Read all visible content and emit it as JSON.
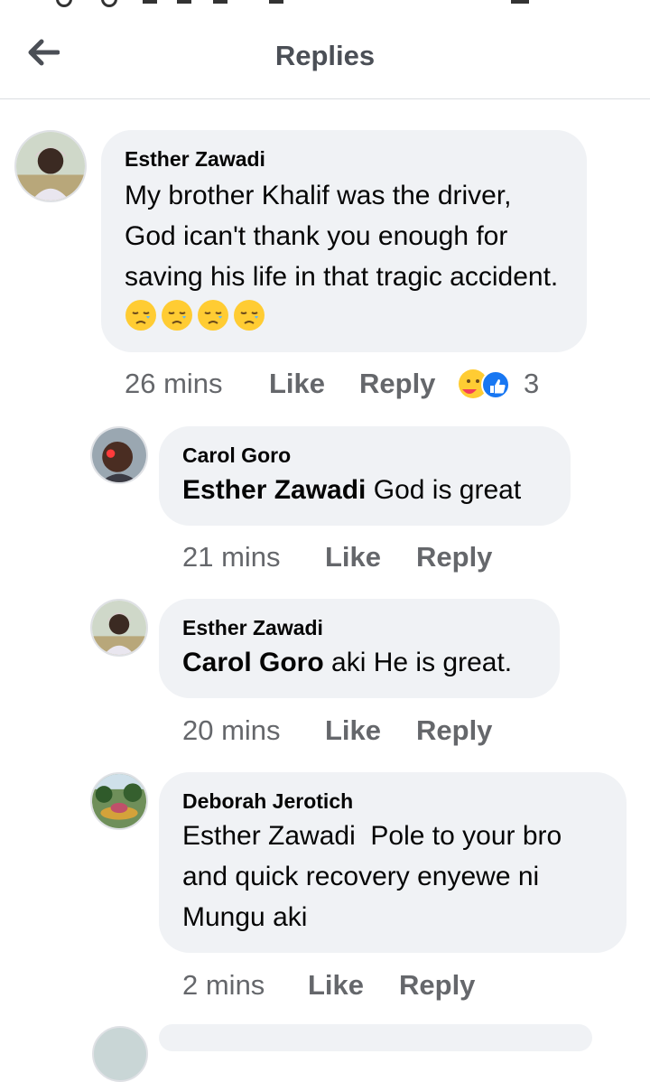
{
  "header": {
    "title": "Replies",
    "back_icon": "arrow-left-icon"
  },
  "comments": [
    {
      "author": "Esther Zawadi",
      "mention": "",
      "text": "My brother Khalif was the driver, God ican't thank you enough for saving his life in that tragic accident.",
      "time": "26 mins",
      "like_label": "Like",
      "reply_label": "Reply",
      "reaction_count": "3",
      "reactions": [
        "care-emoji-icon",
        "like-icon"
      ]
    },
    {
      "author": "Carol Goro",
      "mention": "Esther Zawadi",
      "text": "God is great",
      "time": "21 mins",
      "like_label": "Like",
      "reply_label": "Reply"
    },
    {
      "author": "Esther Zawadi",
      "mention": "Carol Goro",
      "text": "aki He is great.",
      "time": "20 mins",
      "like_label": "Like",
      "reply_label": "Reply"
    },
    {
      "author": "Deborah Jerotich",
      "mention": "",
      "text": "Esther Zawadi  Pole to your bro and quick recovery enyewe ni Mungu aki",
      "time": "2 mins",
      "like_label": "Like",
      "reply_label": "Reply"
    }
  ],
  "colors": {
    "bubble": "#f0f2f5",
    "secondary_text": "#65676b",
    "like_blue": "#1877f2"
  }
}
